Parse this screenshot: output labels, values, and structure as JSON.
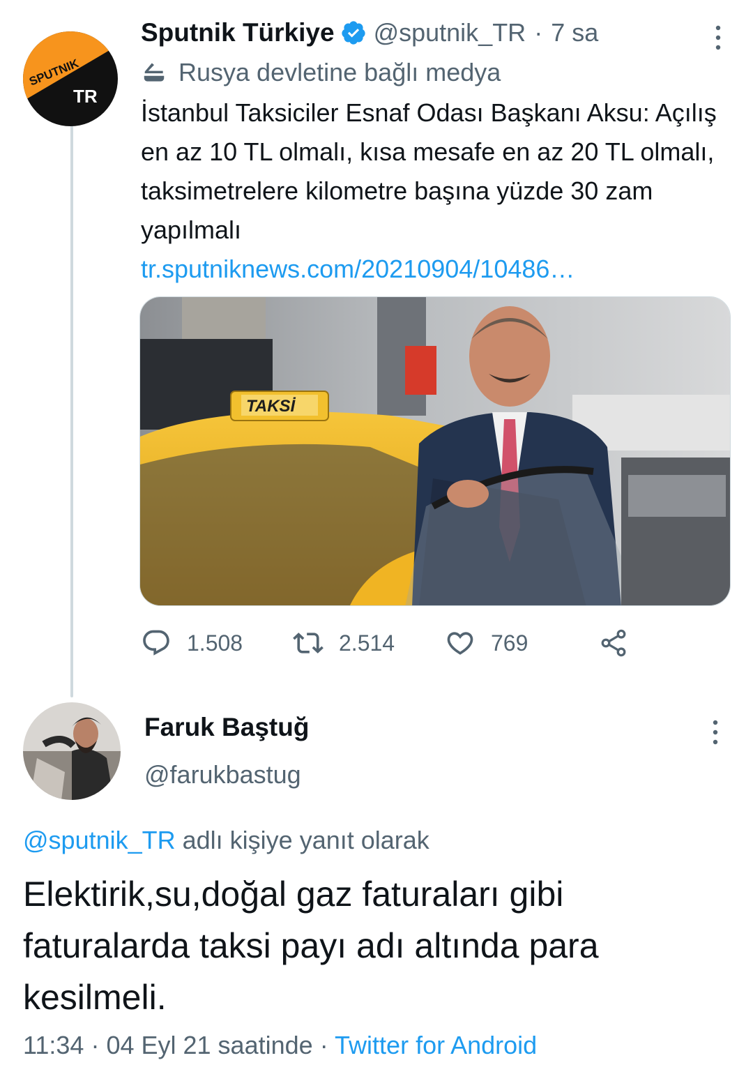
{
  "parent_tweet": {
    "author_name": "Sputnik Türkiye",
    "handle": "@sputnik_TR",
    "separator": "·",
    "time": "7 sa",
    "state_label": "Rusya devletine bağlı medya",
    "text": "İstanbul Taksiciler Esnaf Odası Başkanı Aksu: Açılış en az 10 TL olmalı, kısa mesafe en az 20 TL olmalı, taksimetrelere kilometre başına yüzde 30 zam yapılmalı",
    "link": "tr.sputniknews.com/20210904/10486…",
    "avatar_text": {
      "top": "SPUTNIK",
      "bottom": "TR"
    },
    "photo_sign_text": "TAKSİ",
    "stats": {
      "replies": "1.508",
      "retweets": "2.514",
      "likes": "769"
    }
  },
  "reply_tweet": {
    "author_name": "Faruk Baştuğ",
    "handle": "@farukbastug",
    "reply_mention": "@sputnik_TR",
    "reply_suffix": "adlı kişiye yanıt olarak",
    "text": "Elektirik,su,doğal gaz faturaları gibi faturalarda taksi payı adı altında para kesilmeli.",
    "time": "11:34",
    "separator": "·",
    "date": "04 Eyl 21 saatinde",
    "client": "Twitter for Android"
  },
  "colors": {
    "accent": "#1d9bf0",
    "secondary_text": "#536471",
    "primary_text": "#0f1419",
    "thread_line": "#cfd9de",
    "sputnik_orange": "#f7941d"
  },
  "icons": [
    "verified-badge-icon",
    "state-media-icon",
    "more-icon",
    "reply-icon",
    "retweet-icon",
    "like-icon",
    "share-icon"
  ]
}
